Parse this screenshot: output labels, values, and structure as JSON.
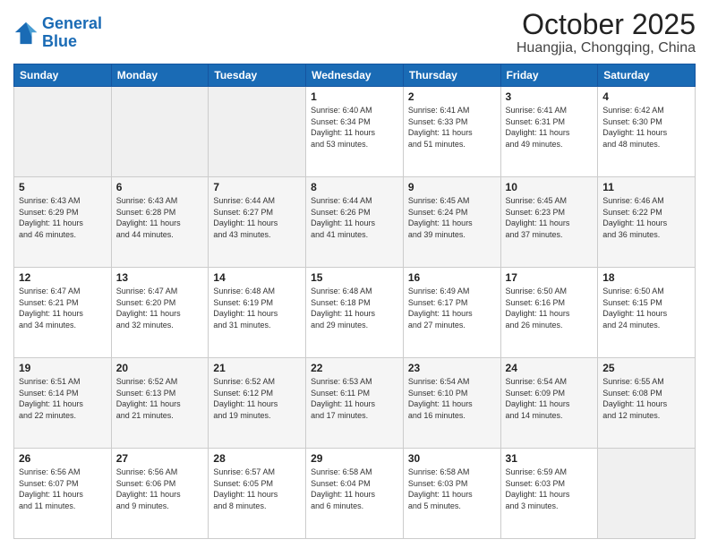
{
  "header": {
    "logo_line1": "General",
    "logo_line2": "Blue",
    "month": "October 2025",
    "location": "Huangjia, Chongqing, China"
  },
  "weekdays": [
    "Sunday",
    "Monday",
    "Tuesday",
    "Wednesday",
    "Thursday",
    "Friday",
    "Saturday"
  ],
  "weeks": [
    [
      {
        "day": "",
        "info": ""
      },
      {
        "day": "",
        "info": ""
      },
      {
        "day": "",
        "info": ""
      },
      {
        "day": "1",
        "info": "Sunrise: 6:40 AM\nSunset: 6:34 PM\nDaylight: 11 hours\nand 53 minutes."
      },
      {
        "day": "2",
        "info": "Sunrise: 6:41 AM\nSunset: 6:33 PM\nDaylight: 11 hours\nand 51 minutes."
      },
      {
        "day": "3",
        "info": "Sunrise: 6:41 AM\nSunset: 6:31 PM\nDaylight: 11 hours\nand 49 minutes."
      },
      {
        "day": "4",
        "info": "Sunrise: 6:42 AM\nSunset: 6:30 PM\nDaylight: 11 hours\nand 48 minutes."
      }
    ],
    [
      {
        "day": "5",
        "info": "Sunrise: 6:43 AM\nSunset: 6:29 PM\nDaylight: 11 hours\nand 46 minutes."
      },
      {
        "day": "6",
        "info": "Sunrise: 6:43 AM\nSunset: 6:28 PM\nDaylight: 11 hours\nand 44 minutes."
      },
      {
        "day": "7",
        "info": "Sunrise: 6:44 AM\nSunset: 6:27 PM\nDaylight: 11 hours\nand 43 minutes."
      },
      {
        "day": "8",
        "info": "Sunrise: 6:44 AM\nSunset: 6:26 PM\nDaylight: 11 hours\nand 41 minutes."
      },
      {
        "day": "9",
        "info": "Sunrise: 6:45 AM\nSunset: 6:24 PM\nDaylight: 11 hours\nand 39 minutes."
      },
      {
        "day": "10",
        "info": "Sunrise: 6:45 AM\nSunset: 6:23 PM\nDaylight: 11 hours\nand 37 minutes."
      },
      {
        "day": "11",
        "info": "Sunrise: 6:46 AM\nSunset: 6:22 PM\nDaylight: 11 hours\nand 36 minutes."
      }
    ],
    [
      {
        "day": "12",
        "info": "Sunrise: 6:47 AM\nSunset: 6:21 PM\nDaylight: 11 hours\nand 34 minutes."
      },
      {
        "day": "13",
        "info": "Sunrise: 6:47 AM\nSunset: 6:20 PM\nDaylight: 11 hours\nand 32 minutes."
      },
      {
        "day": "14",
        "info": "Sunrise: 6:48 AM\nSunset: 6:19 PM\nDaylight: 11 hours\nand 31 minutes."
      },
      {
        "day": "15",
        "info": "Sunrise: 6:48 AM\nSunset: 6:18 PM\nDaylight: 11 hours\nand 29 minutes."
      },
      {
        "day": "16",
        "info": "Sunrise: 6:49 AM\nSunset: 6:17 PM\nDaylight: 11 hours\nand 27 minutes."
      },
      {
        "day": "17",
        "info": "Sunrise: 6:50 AM\nSunset: 6:16 PM\nDaylight: 11 hours\nand 26 minutes."
      },
      {
        "day": "18",
        "info": "Sunrise: 6:50 AM\nSunset: 6:15 PM\nDaylight: 11 hours\nand 24 minutes."
      }
    ],
    [
      {
        "day": "19",
        "info": "Sunrise: 6:51 AM\nSunset: 6:14 PM\nDaylight: 11 hours\nand 22 minutes."
      },
      {
        "day": "20",
        "info": "Sunrise: 6:52 AM\nSunset: 6:13 PM\nDaylight: 11 hours\nand 21 minutes."
      },
      {
        "day": "21",
        "info": "Sunrise: 6:52 AM\nSunset: 6:12 PM\nDaylight: 11 hours\nand 19 minutes."
      },
      {
        "day": "22",
        "info": "Sunrise: 6:53 AM\nSunset: 6:11 PM\nDaylight: 11 hours\nand 17 minutes."
      },
      {
        "day": "23",
        "info": "Sunrise: 6:54 AM\nSunset: 6:10 PM\nDaylight: 11 hours\nand 16 minutes."
      },
      {
        "day": "24",
        "info": "Sunrise: 6:54 AM\nSunset: 6:09 PM\nDaylight: 11 hours\nand 14 minutes."
      },
      {
        "day": "25",
        "info": "Sunrise: 6:55 AM\nSunset: 6:08 PM\nDaylight: 11 hours\nand 12 minutes."
      }
    ],
    [
      {
        "day": "26",
        "info": "Sunrise: 6:56 AM\nSunset: 6:07 PM\nDaylight: 11 hours\nand 11 minutes."
      },
      {
        "day": "27",
        "info": "Sunrise: 6:56 AM\nSunset: 6:06 PM\nDaylight: 11 hours\nand 9 minutes."
      },
      {
        "day": "28",
        "info": "Sunrise: 6:57 AM\nSunset: 6:05 PM\nDaylight: 11 hours\nand 8 minutes."
      },
      {
        "day": "29",
        "info": "Sunrise: 6:58 AM\nSunset: 6:04 PM\nDaylight: 11 hours\nand 6 minutes."
      },
      {
        "day": "30",
        "info": "Sunrise: 6:58 AM\nSunset: 6:03 PM\nDaylight: 11 hours\nand 5 minutes."
      },
      {
        "day": "31",
        "info": "Sunrise: 6:59 AM\nSunset: 6:03 PM\nDaylight: 11 hours\nand 3 minutes."
      },
      {
        "day": "",
        "info": ""
      }
    ]
  ]
}
